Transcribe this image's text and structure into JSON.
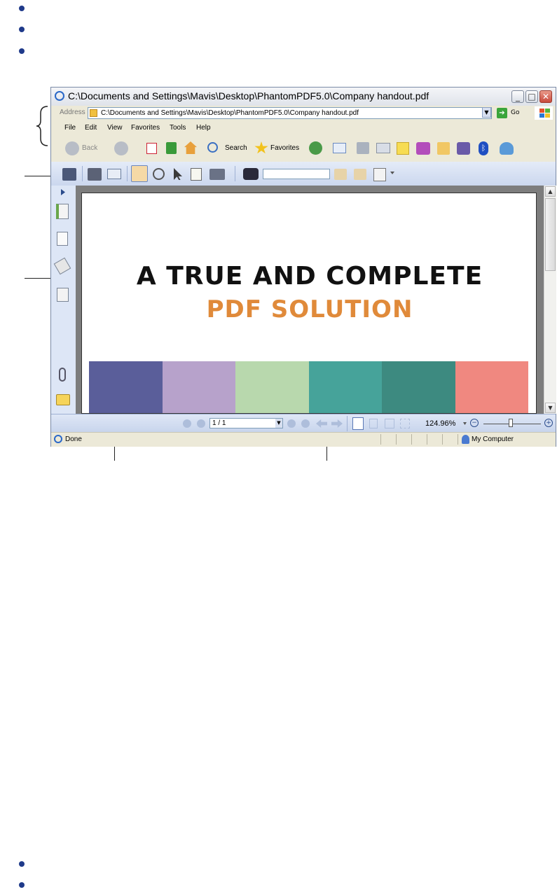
{
  "window": {
    "title": "C:\\Documents and Settings\\Mavis\\Desktop\\PhantomPDF5.0\\Company handout.pdf"
  },
  "address_bar": {
    "label": "Address",
    "value": "C:\\Documents and Settings\\Mavis\\Desktop\\PhantomPDF5.0\\Company handout.pdf",
    "go_label": "Go"
  },
  "menu": {
    "items": [
      "File",
      "Edit",
      "View",
      "Favorites",
      "Tools",
      "Help"
    ]
  },
  "ie_toolbar": {
    "back_label": "Back",
    "search_label": "Search",
    "favorites_label": "Favorites"
  },
  "document": {
    "heading_line1": "A TRUE AND COMPLETE",
    "heading_line2": "PDF SOLUTION",
    "heading_line2_color": "#e08a3a",
    "color_bands": [
      "#5a5e9a",
      "#b7a2cb",
      "#b8d8ad",
      "#46a39a",
      "#3d8a80",
      "#f08880"
    ]
  },
  "navigation": {
    "page_indicator": "1 / 1",
    "zoom": "124.96%",
    "zoom_level_fraction": 0.47
  },
  "status_bar": {
    "left_text": "Done",
    "zone_text": "My Computer"
  }
}
